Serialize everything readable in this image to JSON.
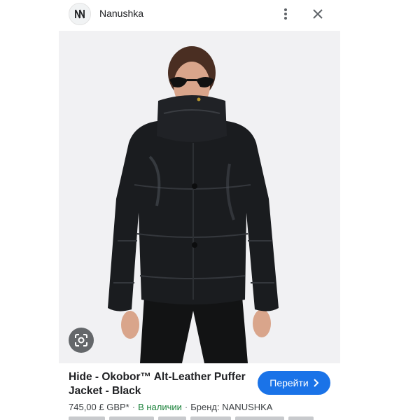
{
  "header": {
    "site_name": "Nanushka",
    "logo_icon": "nanushka-logo-icon",
    "more_icon": "more-vert-icon",
    "close_icon": "close-icon"
  },
  "image": {
    "alt": "Model wearing black leather puffer jacket",
    "lens_icon": "google-lens-icon"
  },
  "product": {
    "title": "Hide - Okobor™ Alt-Leather Puffer Jacket - Black",
    "price": "745,00 £ GBP*",
    "availability": "В наличии",
    "brand": "Бренд: NANUSHKA",
    "visit_label": "Перейти"
  },
  "colors": {
    "accent": "#1a73e8",
    "in_stock": "#188038"
  }
}
